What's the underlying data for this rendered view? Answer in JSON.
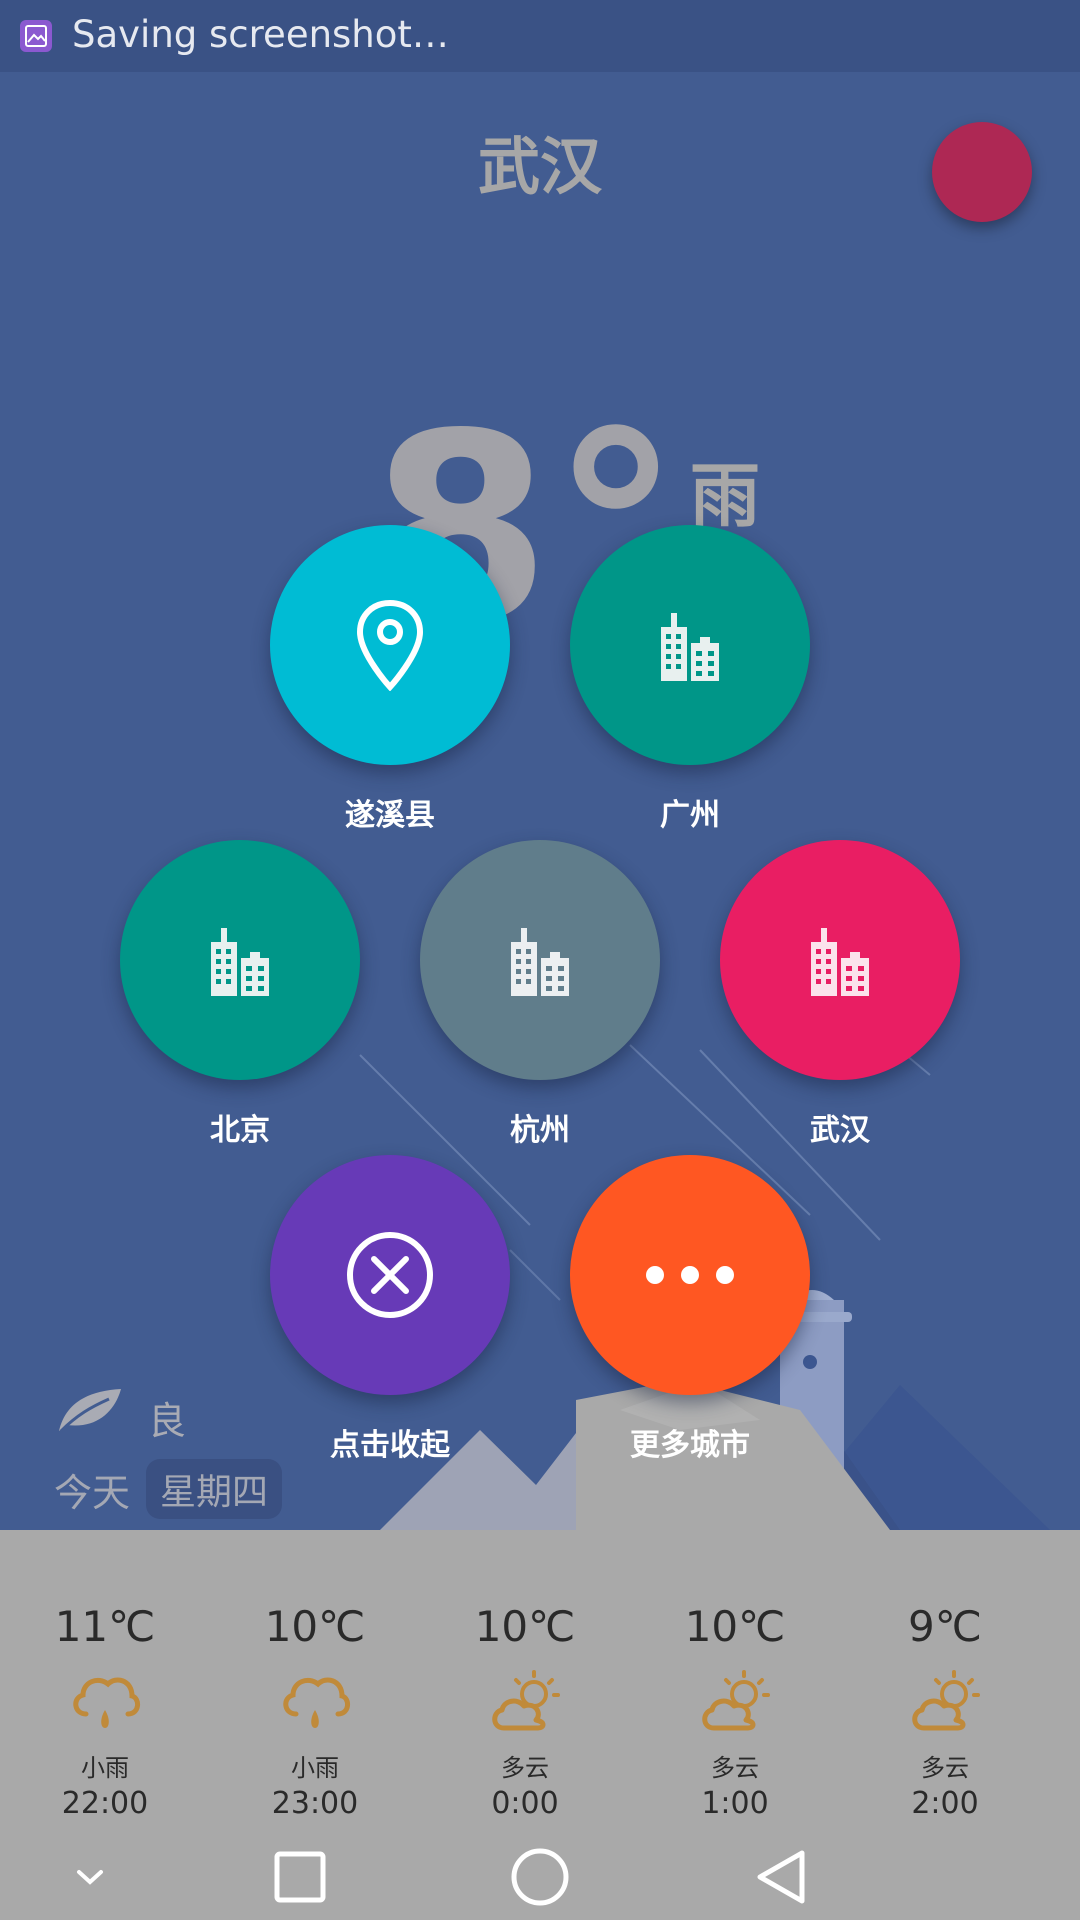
{
  "status_bar": {
    "notification_text": "Saving screenshot…",
    "icon": "screenshot-icon"
  },
  "header": {
    "city": "武汉"
  },
  "current": {
    "temperature": "8°",
    "condition": "雨"
  },
  "aqi": {
    "level": "良",
    "icon": "leaf-icon"
  },
  "date": {
    "today_label": "今天",
    "weekday": "星期四"
  },
  "city_menu": {
    "items": [
      {
        "label": "遂溪县",
        "icon": "location-pin-icon",
        "color": "#00bcd4"
      },
      {
        "label": "广州",
        "icon": "city-buildings-icon",
        "color": "#009688"
      },
      {
        "label": "北京",
        "icon": "city-buildings-icon",
        "color": "#009688"
      },
      {
        "label": "杭州",
        "icon": "city-buildings-icon",
        "color": "#607d8b"
      },
      {
        "label": "武汉",
        "icon": "city-buildings-icon",
        "color": "#e91e63"
      },
      {
        "label": "点击收起",
        "icon": "close-circle-icon",
        "color": "#673ab7"
      },
      {
        "label": "更多城市",
        "icon": "more-dots-icon",
        "color": "#ff5722"
      }
    ]
  },
  "hourly_forecast": [
    {
      "temp": "11℃",
      "condition": "小雨",
      "time": "22:00",
      "icon": "rain-cloud-icon"
    },
    {
      "temp": "10℃",
      "condition": "小雨",
      "time": "23:00",
      "icon": "rain-cloud-icon"
    },
    {
      "temp": "10℃",
      "condition": "多云",
      "time": "0:00",
      "icon": "partly-cloudy-icon"
    },
    {
      "temp": "10℃",
      "condition": "多云",
      "time": "1:00",
      "icon": "partly-cloudy-icon"
    },
    {
      "temp": "9℃",
      "condition": "多云",
      "time": "2:00",
      "icon": "partly-cloudy-icon"
    }
  ],
  "navigation": {
    "buttons": [
      "collapse-icon",
      "recents-icon",
      "home-icon",
      "back-icon"
    ]
  },
  "colors": {
    "background": "#425c91",
    "forecast_panel": "#a9a9a9",
    "weather_icon": "#c08a3a",
    "top_fab": "#ae2854"
  }
}
